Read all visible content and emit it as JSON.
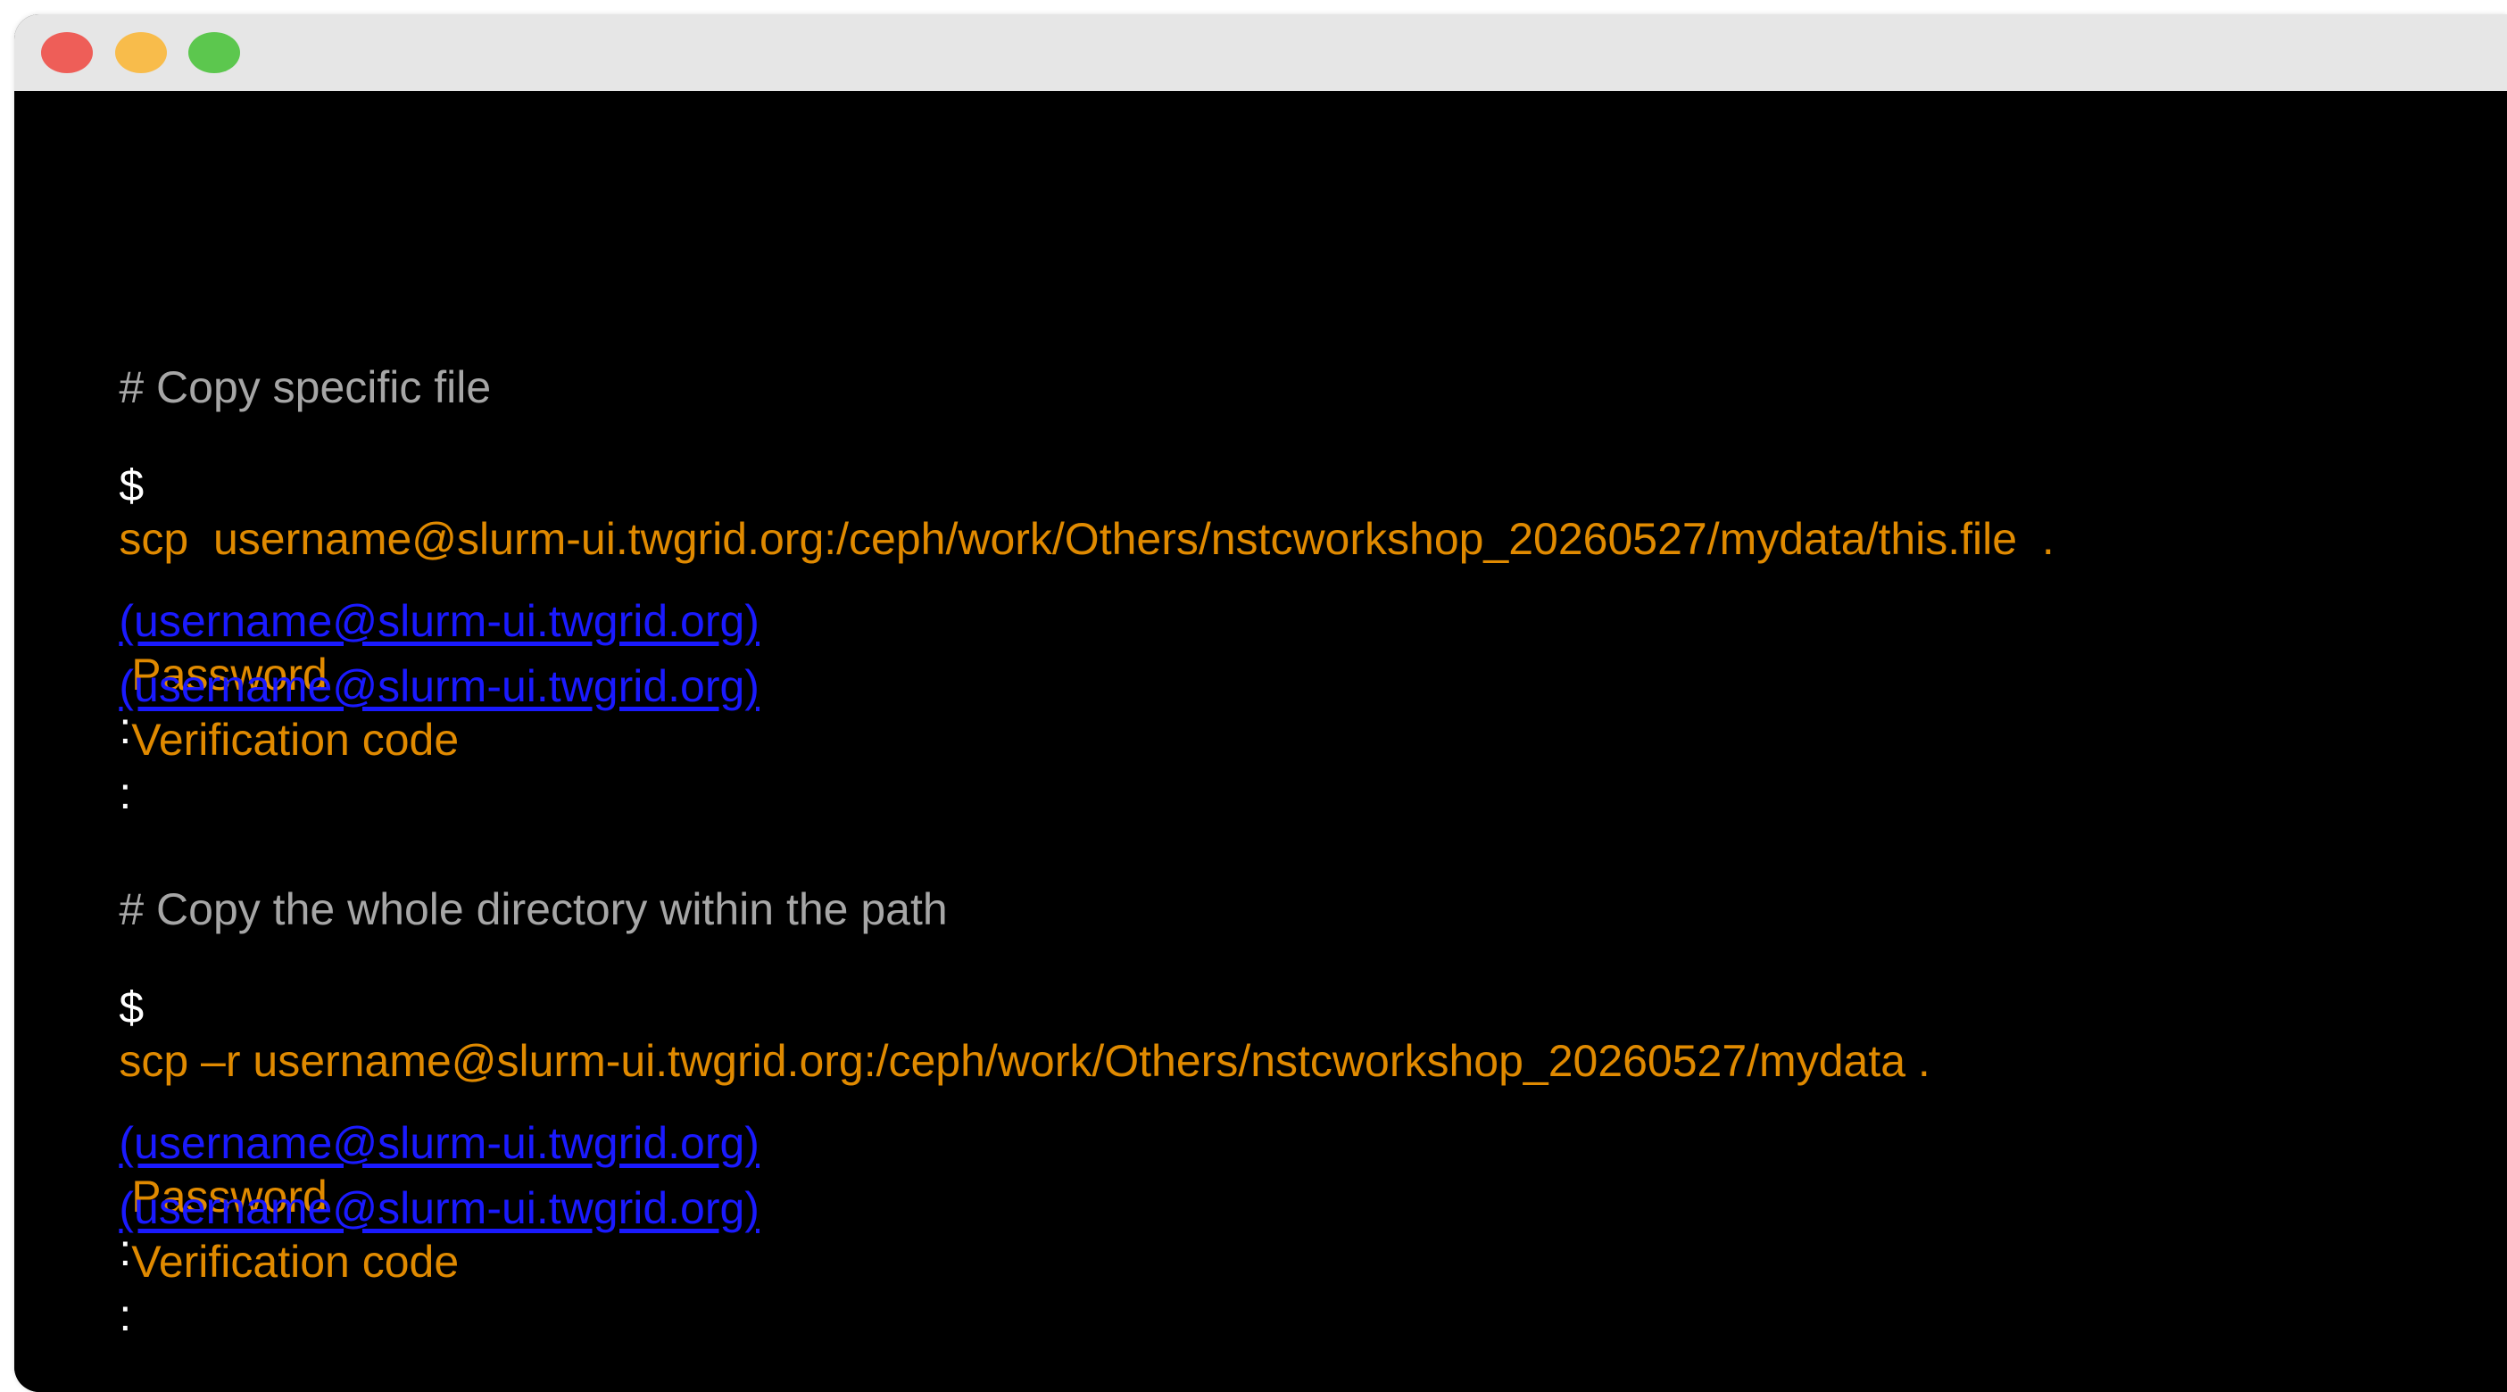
{
  "window": {
    "buttons": {
      "close_color": "#ee5e58",
      "minimize_color": "#f8bc4b",
      "maximize_color": "#5cc74e"
    }
  },
  "terminal": {
    "colors": {
      "background": "#000000",
      "comment": "#a6a6a6",
      "command": "#e08a00",
      "link": "#1a1aff",
      "prompt": "#ffffff"
    },
    "block1": {
      "comment": "# Copy specific file",
      "prompt": "$",
      "command": "scp  username@slurm-ui.twgrid.org:/ceph/work/Others/nstcworkshop_20260527/mydata/this.file  .",
      "password_line": {
        "host": "(username@slurm-ui.twgrid.org)",
        "label": " Password",
        "colon": ":"
      },
      "verification_line": {
        "host": "(username@slurm-ui.twgrid.org)",
        "label": " Verification code",
        "colon": ":"
      }
    },
    "block2": {
      "comment": "# Copy the whole directory within the path",
      "prompt": "$",
      "command": "scp –r username@slurm-ui.twgrid.org:/ceph/work/Others/nstcworkshop_20260527/mydata .",
      "password_line": {
        "host": "(username@slurm-ui.twgrid.org)",
        "label": " Password",
        "colon": ":"
      },
      "verification_line": {
        "host": "(username@slurm-ui.twgrid.org)",
        "label": " Verification code",
        "colon": ":"
      }
    }
  }
}
